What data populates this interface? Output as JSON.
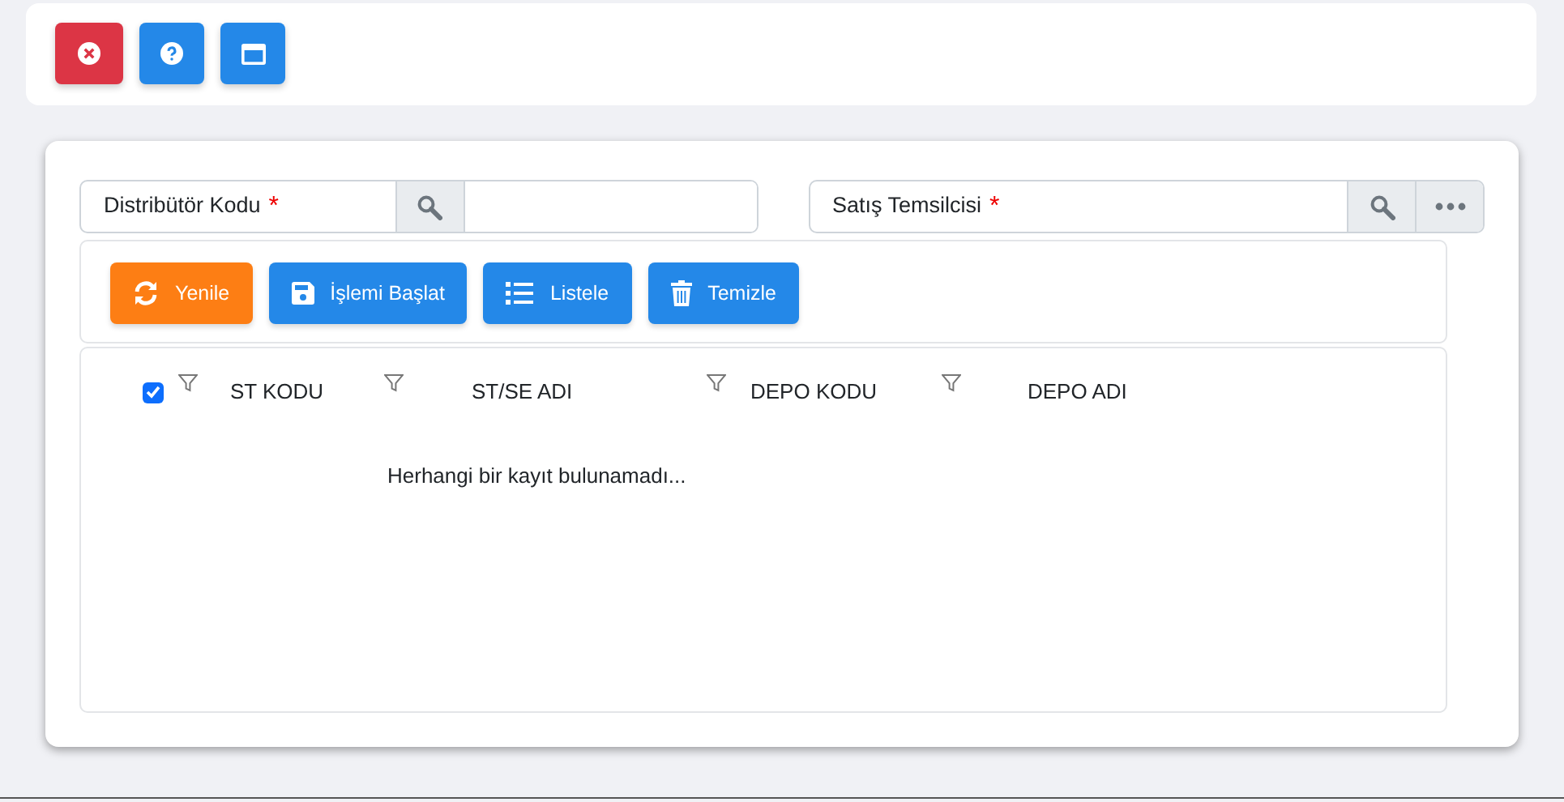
{
  "top_buttons": [
    {
      "kind": "close",
      "color": "#dc3545"
    },
    {
      "kind": "help",
      "color": "#2488e8"
    },
    {
      "kind": "window",
      "color": "#2488e8"
    }
  ],
  "fields": [
    {
      "kind": "input",
      "label": "Distribütör Kodu",
      "required_mark": "*"
    },
    {
      "kind": "more",
      "label": "Satış Temsilcisi",
      "required_mark": "*"
    }
  ],
  "toolbar": [
    {
      "kind": "refresh",
      "label": "Yenile",
      "color": "#fd7e14"
    },
    {
      "kind": "save",
      "label": "İşlemi Başlat",
      "color": "#2488e8"
    },
    {
      "kind": "list",
      "label": "Listele",
      "color": "#2488e8"
    },
    {
      "kind": "trash",
      "label": "Temizle",
      "color": "#2488e8"
    }
  ],
  "grid": {
    "select_all": {
      "checked": true
    },
    "columns": [
      "ST KODU",
      "ST/SE ADI",
      "DEPO KODU",
      "DEPO ADI"
    ],
    "empty_message": "Herhangi bir kayıt bulunamadı..."
  }
}
